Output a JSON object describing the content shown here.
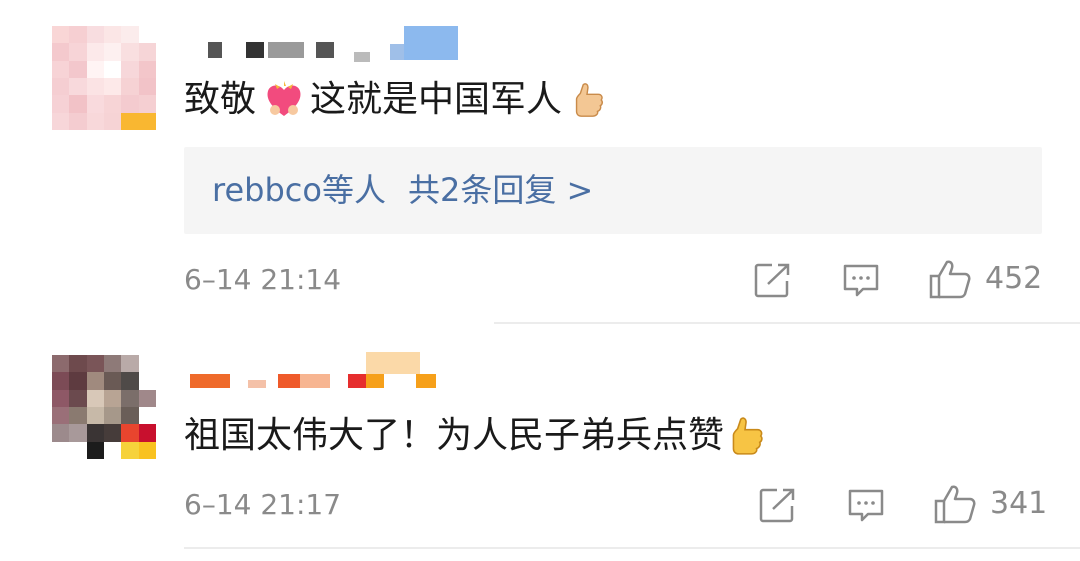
{
  "comments": [
    {
      "text_a": "致敬",
      "text_b": "这就是中国军人",
      "emoji_a": "heart-emoji",
      "emoji_b": "thumbs-up-emoji",
      "reply": {
        "users": "rebbco等人",
        "count_label": "共2条回复 >"
      },
      "timestamp": "6–14 21:14",
      "likes": "452"
    },
    {
      "text_a": "祖国太伟大了！为人民子弟兵点赞",
      "emoji_b": "thumbs-up-emoji",
      "timestamp": "6–14 21:17",
      "likes": "341"
    }
  ],
  "icons": [
    "share-icon",
    "comment-icon",
    "like-icon"
  ],
  "colors": {
    "link": "#4a6fa3",
    "meta": "#8a8a8a",
    "reply_bg": "#f5f5f5",
    "divider": "#ececec"
  }
}
